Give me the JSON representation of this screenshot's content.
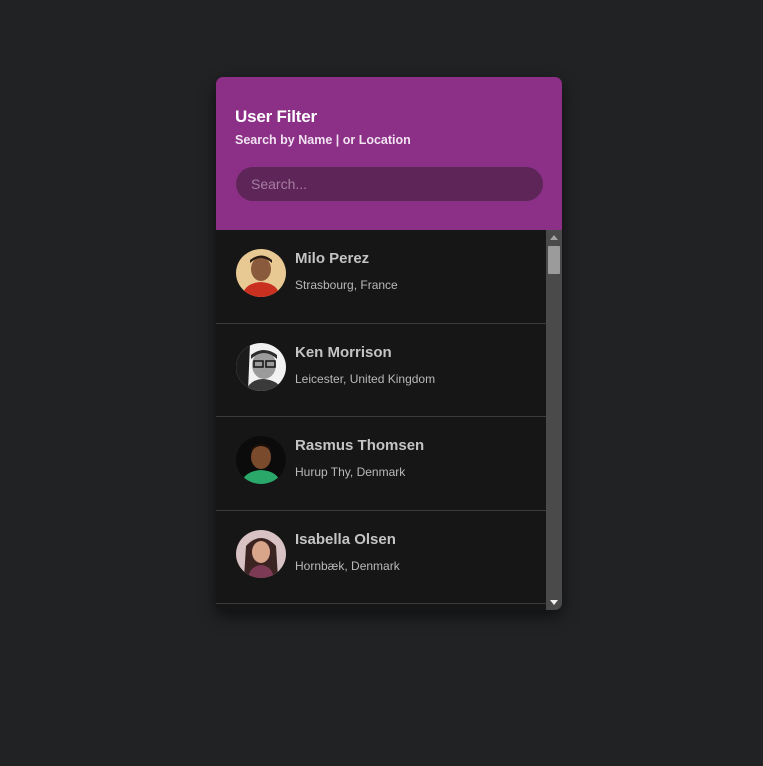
{
  "header": {
    "title": "User Filter",
    "subtitle": "Search by Name | or Location"
  },
  "search": {
    "placeholder": "Search...",
    "value": ""
  },
  "users": [
    {
      "name": "Milo Perez",
      "location": "Strasbourg, France"
    },
    {
      "name": "Ken Morrison",
      "location": "Leicester, United Kingdom"
    },
    {
      "name": "Rasmus Thomsen",
      "location": "Hurup Thy, Denmark"
    },
    {
      "name": "Isabella Olsen",
      "location": "Hornbæk, Denmark"
    }
  ],
  "colors": {
    "page_background": "#212224",
    "header_background": "#8c2f87",
    "search_background": "#5d2558",
    "list_background": "#161616",
    "divider": "#3b3b3b"
  },
  "icons": {
    "scroll_up": "scroll-up-arrow-icon",
    "scroll_down": "scroll-down-arrow-icon"
  }
}
